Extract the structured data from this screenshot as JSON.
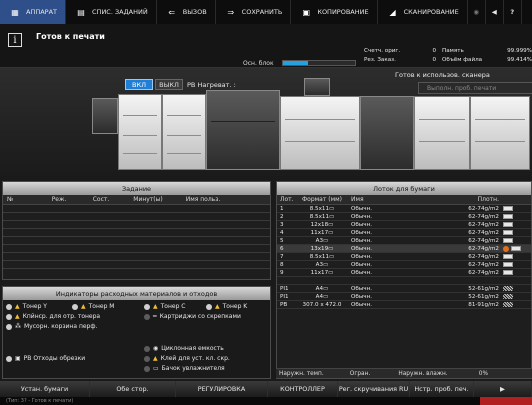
{
  "tabs": [
    {
      "label": "АППАРАТ",
      "icon": "printer-icon",
      "active": true
    },
    {
      "label": "СПИС. ЗАДАНИЙ",
      "icon": "list-icon",
      "active": false
    },
    {
      "label": "ВЫЗОВ",
      "icon": "recall-icon",
      "active": false
    },
    {
      "label": "СОХРАНИТЬ",
      "icon": "save-icon",
      "active": false
    },
    {
      "label": "КОПИРОВАНИЕ",
      "icon": "copy-icon",
      "active": false
    },
    {
      "label": "СКАНИРОВАНИЕ",
      "icon": "scan-icon",
      "active": false
    }
  ],
  "status": {
    "message": "Готов к печати",
    "block_label": "Осн. блок",
    "block_fill": 0.35,
    "ready_text": "Готов к использов. сканера",
    "sample_button": "Выполн. проб. печати"
  },
  "counters": [
    {
      "label": "Счетч. ориг.",
      "value": "0",
      "label2": "Память",
      "value2": "99.999%"
    },
    {
      "label": "Рез. Заказ.",
      "value": "0",
      "label2": "Объём файла",
      "value2": "99.414%"
    }
  ],
  "heater": {
    "on_label": "ВКЛ",
    "off_label": "ВЫКЛ",
    "label": "РВ Нагреват. :"
  },
  "job_panel": {
    "title": "Задание",
    "columns": [
      "№",
      "Реж.",
      "Сост.",
      "Минут(ы)",
      "Имя польз."
    ]
  },
  "tray_panel": {
    "title": "Лоток для бумаги",
    "columns": [
      "Лот.",
      "Формат (мм)",
      "Имя",
      "Плотн."
    ],
    "rows": [
      {
        "tray": "1",
        "format": "8.5x11▭",
        "name": "Обычн.",
        "weight": "62-74g/m2",
        "mark": "swatch"
      },
      {
        "tray": "2",
        "format": "8.5x11▭",
        "name": "Обычн.",
        "weight": "62-74g/m2",
        "mark": "swatch"
      },
      {
        "tray": "3",
        "format": "12x18▭",
        "name": "Обычн.",
        "weight": "62-74g/m2",
        "mark": "swatch"
      },
      {
        "tray": "4",
        "format": "11x17▭",
        "name": "Обычн.",
        "weight": "62-74g/m2",
        "mark": "swatch"
      },
      {
        "tray": "5",
        "format": "A3▭",
        "name": "Обычн.",
        "weight": "62-74g/m2",
        "mark": "swatch"
      },
      {
        "tray": "6",
        "format": "13x19▭",
        "name": "Обычн.",
        "weight": "62-74g/m2",
        "mark": "warn"
      },
      {
        "tray": "7",
        "format": "8.5x11▭",
        "name": "Обычн.",
        "weight": "62-74g/m2",
        "mark": "swatch"
      },
      {
        "tray": "8",
        "format": "A3▭",
        "name": "Обычн.",
        "weight": "62-74g/m2",
        "mark": "swatch"
      },
      {
        "tray": "9",
        "format": "11x17▭",
        "name": "Обычн.",
        "weight": "62-74g/m2",
        "mark": "swatch"
      },
      {
        "tray": "",
        "format": "",
        "name": "",
        "weight": "",
        "mark": ""
      },
      {
        "tray": "PI1",
        "format": "A4▭",
        "name": "Обычн.",
        "weight": "52-61g/m2",
        "mark": "stripes"
      },
      {
        "tray": "PI1",
        "format": "A4▭",
        "name": "Обычн.",
        "weight": "52-61g/m2",
        "mark": "stripes"
      },
      {
        "tray": "PB",
        "format": "307.0 x 472.0",
        "name": "Обычн.",
        "weight": "81-91g/m2",
        "mark": "stripes"
      }
    ],
    "bottom": {
      "left": "Наружн. темп.",
      "mid": "Огран.",
      "right": "Наружн. влажн.",
      "value": "0%"
    }
  },
  "consumables": {
    "title": "Индикаторы расходных материалов и отходов",
    "items": [
      {
        "label": "Тонер Y"
      },
      {
        "label": "Тонер M"
      },
      {
        "label": "Тонер C"
      },
      {
        "label": "Тонер K"
      },
      {
        "label": "Кпйнср. для отр. тонера"
      },
      {
        "label": "Картриджи со скрепками"
      },
      {
        "label": "Мусорн. корзина перф."
      },
      {
        "label": "Циклонная емкость"
      },
      {
        "label": "РВ Отходы обрезки"
      },
      {
        "label": "Клей для уст. кл. скр."
      },
      {
        "label": "Бачок увлажнителя"
      }
    ]
  },
  "bottom_bar": [
    "Устан. бумаги",
    "Обе стор.",
    "РЕГУЛИРОВКА",
    "КОНТРОЛЛЕР",
    "Рег. скручивания RU",
    "Нстр. проб. печ."
  ],
  "footer": "(Тип: 3? - Готов к печати)"
}
